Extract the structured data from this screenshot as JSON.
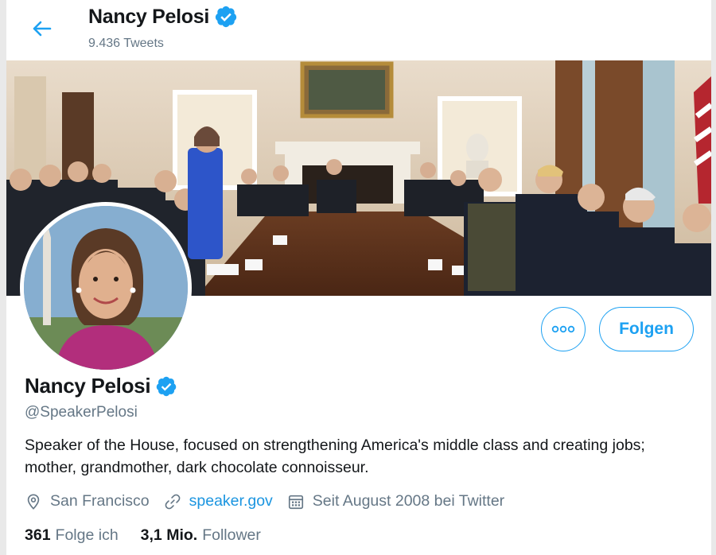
{
  "header": {
    "display_name": "Nancy Pelosi",
    "tweet_count": "9.436 Tweets"
  },
  "profile": {
    "display_name": "Nancy Pelosi",
    "handle": "@SpeakerPelosi",
    "bio": "Speaker of the House, focused on strengthening America's middle class and creating jobs; mother, grandmother, dark chocolate connoisseur.",
    "location": "San Francisco",
    "website": "speaker.gov",
    "joined": "Seit August 2008 bei Twitter"
  },
  "actions": {
    "more_label": "ooo",
    "follow_label": "Folgen"
  },
  "stats": {
    "following_count": "361",
    "following_label": "Folge ich",
    "followers_count": "3,1 Mio.",
    "followers_label": "Follower"
  },
  "icons": {
    "back": "arrow-left-icon",
    "verified": "verified-badge-icon",
    "location": "location-pin-icon",
    "link": "link-icon",
    "calendar": "calendar-icon"
  },
  "colors": {
    "accent": "#1da1f2",
    "link": "#1b95e0",
    "secondary_text": "#657786",
    "primary_text": "#14171a"
  }
}
